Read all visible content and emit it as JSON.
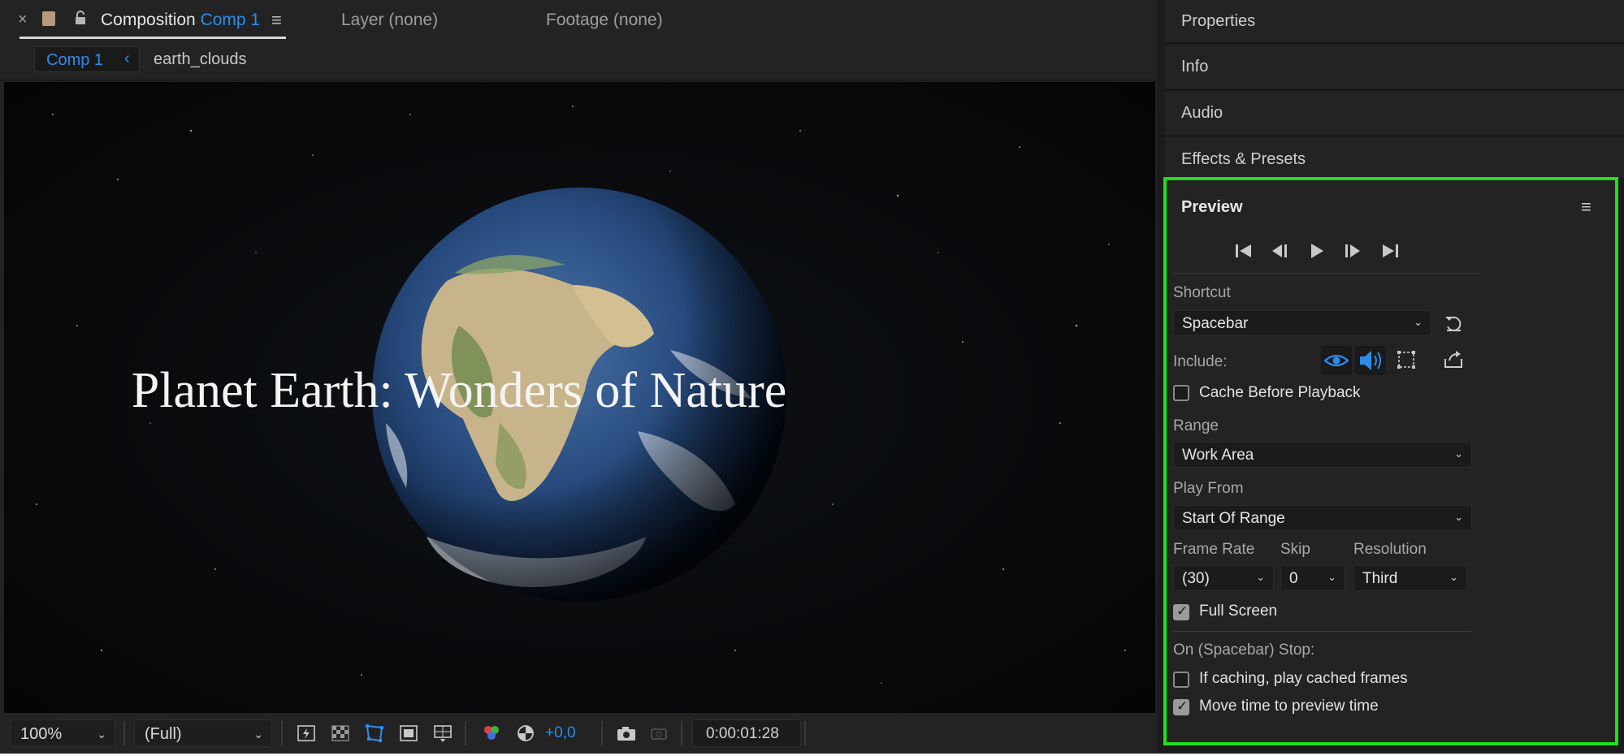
{
  "composition_panel": {
    "tabs": [
      {
        "label": "Composition",
        "sub": "Comp 1"
      },
      {
        "label": "Layer (none)"
      },
      {
        "label": "Footage (none)"
      }
    ],
    "sub_tabs": [
      "Comp 1",
      "earth_clouds"
    ],
    "viewer": {
      "title_text": "Planet Earth: Wonders of Nature"
    },
    "bottom_bar": {
      "zoom": "100%",
      "resolution": "(Full)",
      "exposure": "+0,0",
      "timecode": "0:00:01:28"
    }
  },
  "side_panels": {
    "properties": "Properties",
    "info": "Info",
    "audio": "Audio",
    "effects": "Effects & Presets"
  },
  "preview": {
    "title": "Preview",
    "shortcut_label": "Shortcut",
    "shortcut_value": "Spacebar",
    "include_label": "Include:",
    "cache_before_playback": "Cache Before Playback",
    "range_label": "Range",
    "range_value": "Work Area",
    "play_from_label": "Play From",
    "play_from_value": "Start Of Range",
    "frame_rate_label": "Frame Rate",
    "frame_rate_value": "(30)",
    "skip_label": "Skip",
    "skip_value": "0",
    "resolution_label": "Resolution",
    "resolution_value": "Third",
    "full_screen": "Full Screen",
    "on_stop_label": "On (Spacebar) Stop:",
    "if_caching": "If caching, play cached frames",
    "move_time": "Move time to preview time",
    "checks": {
      "cache_before_playback": false,
      "full_screen": true,
      "if_caching": false,
      "move_time": true
    }
  },
  "colors": {
    "accent_blue": "#2d8ceb",
    "highlight_green": "#1fe01f",
    "panel_bg": "#232323"
  }
}
